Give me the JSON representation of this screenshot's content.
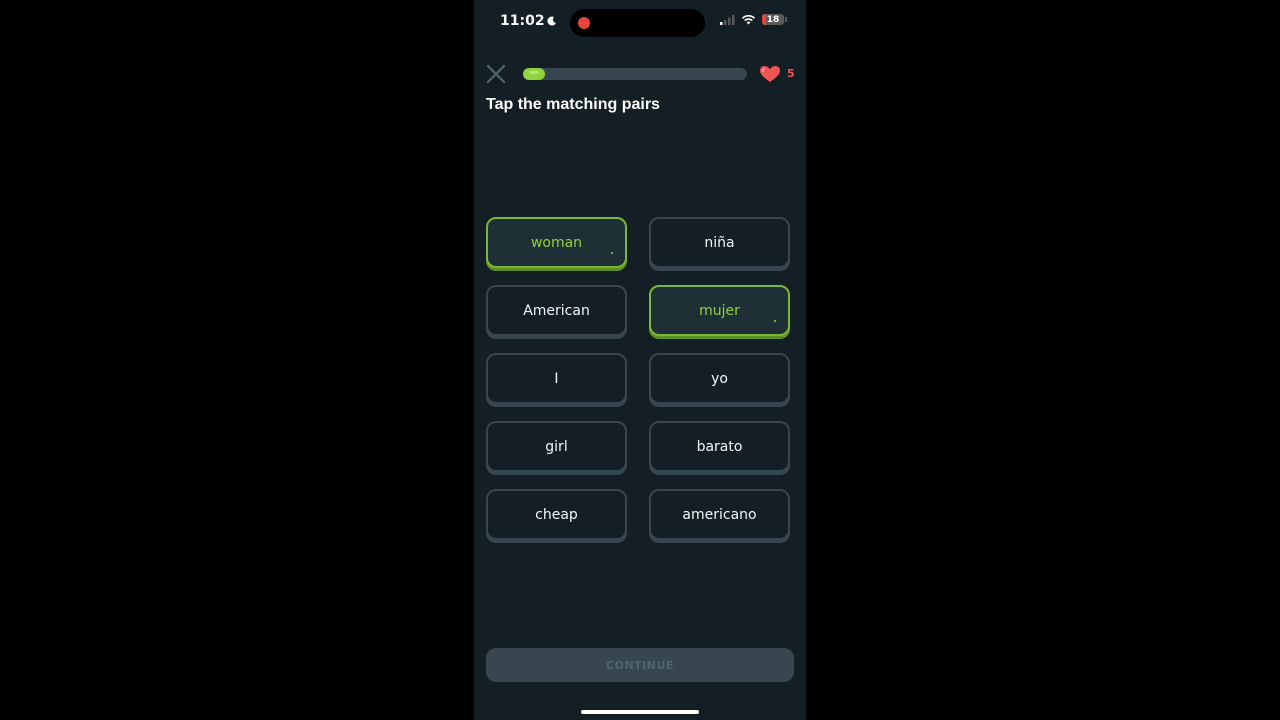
{
  "status_bar": {
    "time": "11:02",
    "battery": "18",
    "icons": [
      "moon-icon",
      "recording-dot-icon",
      "cellular-signal-icon",
      "wifi-icon",
      "battery-icon"
    ]
  },
  "header": {
    "progress": 0.1,
    "hearts": "5",
    "icons": [
      "close-icon",
      "heart-icon"
    ]
  },
  "prompt": "Tap the matching pairs",
  "left_column": [
    {
      "label": "woman",
      "selected": true
    },
    {
      "label": "American",
      "selected": false
    },
    {
      "label": "I",
      "selected": false
    },
    {
      "label": "girl",
      "selected": false
    },
    {
      "label": "cheap",
      "selected": false
    }
  ],
  "right_column": [
    {
      "label": "niña",
      "selected": false
    },
    {
      "label": "mujer",
      "selected": true
    },
    {
      "label": "yo",
      "selected": false
    },
    {
      "label": "barato",
      "selected": false
    },
    {
      "label": "americano",
      "selected": false
    }
  ],
  "footer": {
    "continue_label": "CONTINUE"
  },
  "colors": {
    "background": "#131f24",
    "accent_green": "#8fd33a",
    "tile_border": "#37464f",
    "heart": "#ee5555"
  }
}
